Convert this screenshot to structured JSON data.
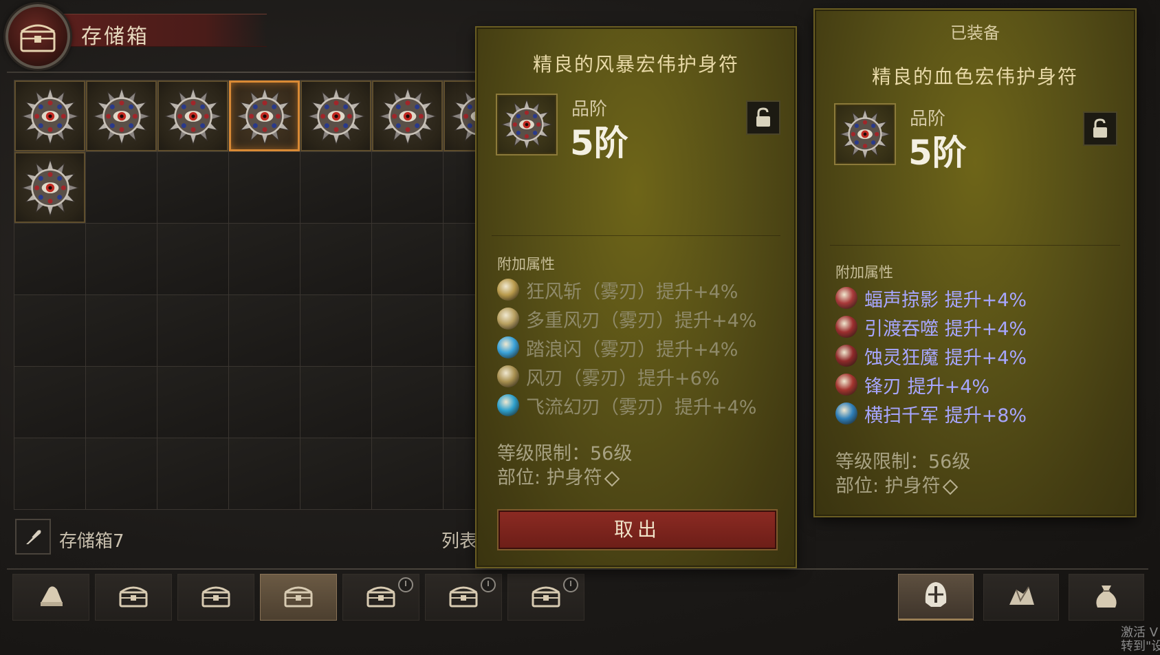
{
  "header": {
    "title": "存储箱"
  },
  "grid": {
    "columns": 10,
    "rows": 6,
    "items": [
      {
        "slot": 0,
        "icon": "amulet-icon",
        "selected": false
      },
      {
        "slot": 1,
        "icon": "amulet-icon",
        "selected": false
      },
      {
        "slot": 2,
        "icon": "amulet-icon",
        "selected": false
      },
      {
        "slot": 3,
        "icon": "amulet-icon",
        "selected": true
      },
      {
        "slot": 4,
        "icon": "amulet-icon",
        "selected": false
      },
      {
        "slot": 5,
        "icon": "amulet-icon",
        "selected": false
      },
      {
        "slot": 6,
        "icon": "amulet-icon",
        "selected": false
      },
      {
        "slot": 10,
        "icon": "amulet-icon",
        "selected": false
      }
    ]
  },
  "storage_footer": {
    "name": "存储箱7",
    "list_label": "列表"
  },
  "bottom_tabs": [
    {
      "icon": "bag-icon",
      "active": false,
      "locked": false
    },
    {
      "icon": "chest-icon",
      "active": false,
      "locked": false
    },
    {
      "icon": "chest-icon",
      "active": false,
      "locked": false
    },
    {
      "icon": "chest-icon",
      "active": true,
      "locked": false
    },
    {
      "icon": "chest-icon",
      "active": false,
      "locked": true
    },
    {
      "icon": "chest-icon",
      "active": false,
      "locked": true
    },
    {
      "icon": "chest-icon",
      "active": false,
      "locked": true
    }
  ],
  "right_tabs": [
    {
      "icon": "helmet-icon",
      "active": true
    },
    {
      "icon": "gem-pile-icon",
      "active": false
    },
    {
      "icon": "sack-icon",
      "active": false
    }
  ],
  "selected_item": {
    "name": "精良的风暴宏伟护身符",
    "grade_label": "品阶",
    "grade_value": "5阶",
    "section_label": "附加属性",
    "affixes": [
      {
        "text": "狂风斩（雾刃）提升+4%",
        "icon_color": "#b89a4c"
      },
      {
        "text": "多重风刃（雾刃）提升+4%",
        "icon_color": "#b8a060"
      },
      {
        "text": "踏浪闪（雾刃）提升+4%",
        "icon_color": "#3aa2d8"
      },
      {
        "text": "风刃（雾刃）提升+6%",
        "icon_color": "#a89050"
      },
      {
        "text": "飞流幻刃（雾刃）提升+4%",
        "icon_color": "#2ea0cc"
      }
    ],
    "level_req": "等级限制：56级",
    "slot": "部位: 护身符",
    "action_button": "取出"
  },
  "equipped_item": {
    "tag": "已装备",
    "name": "精良的血色宏伟护身符",
    "grade_label": "品阶",
    "grade_value": "5阶",
    "section_label": "附加属性",
    "affixes": [
      {
        "text": "蝠声掠影  提升+4%",
        "icon_color": "#a83a3a"
      },
      {
        "text": "引渡吞噬  提升+4%",
        "icon_color": "#9c2f2f"
      },
      {
        "text": "蚀灵狂魔  提升+4%",
        "icon_color": "#8f2a2a"
      },
      {
        "text": "锋刃  提升+4%",
        "icon_color": "#a3352f"
      },
      {
        "text": "横扫千军  提升+8%",
        "icon_color": "#2f7fb8"
      }
    ],
    "level_req": "等级限制：56级",
    "slot": "部位: 护身符"
  },
  "watermark": {
    "line1": "激活 V",
    "line2": "转到\"设"
  },
  "colors": {
    "selected_border": "#d98a35",
    "equipped_affix": "#a7a6ff",
    "button_red": "#8b2a22"
  }
}
